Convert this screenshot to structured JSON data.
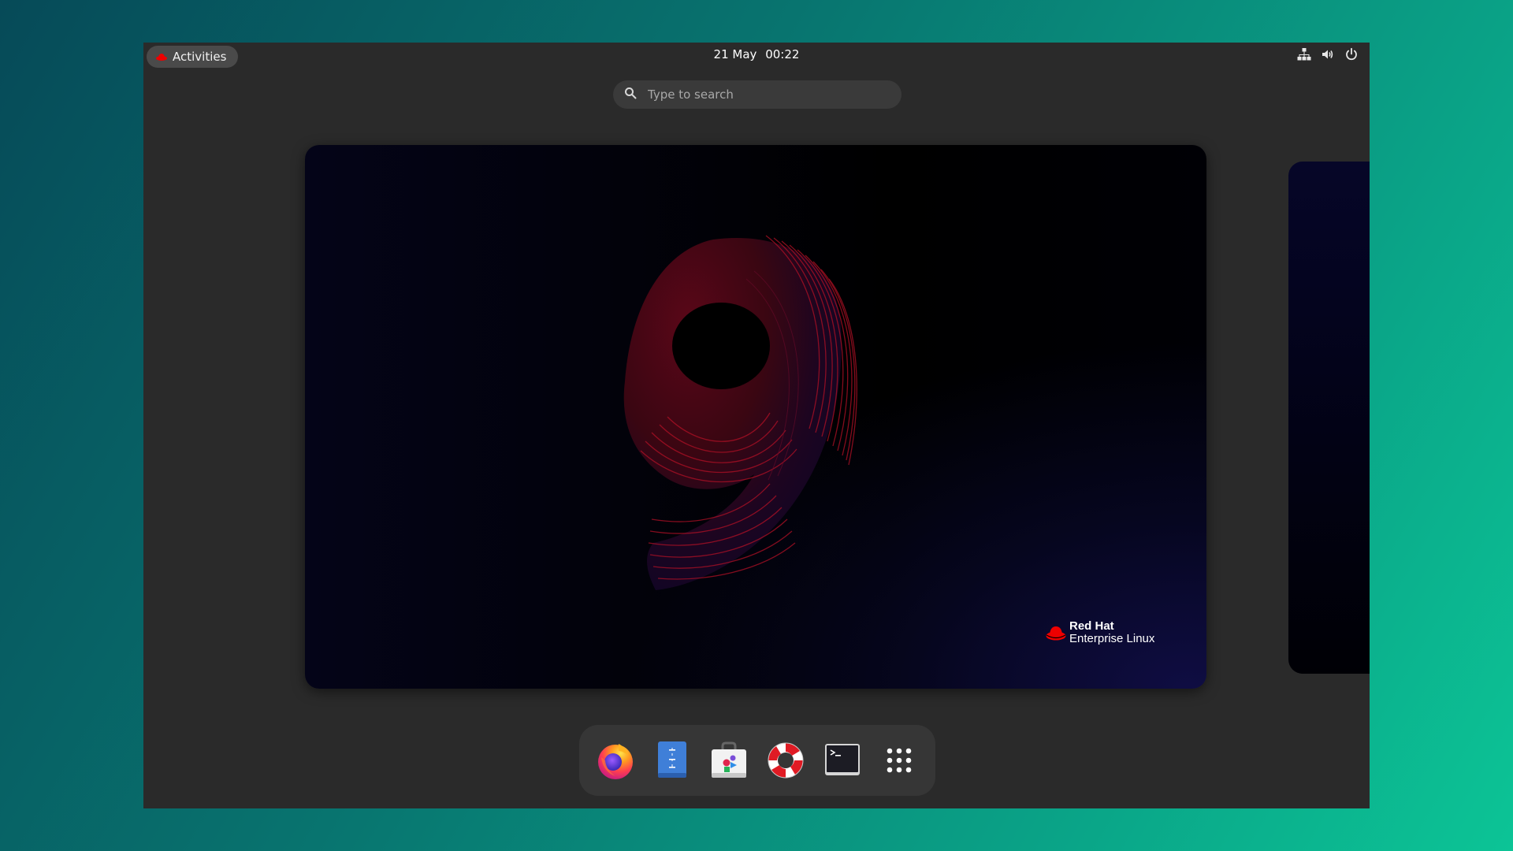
{
  "topbar": {
    "activities_label": "Activities",
    "date": "21 May",
    "time": "00:22",
    "tray_icons": [
      "network-icon",
      "volume-icon",
      "power-icon"
    ]
  },
  "search": {
    "placeholder": "Type to search"
  },
  "workspace": {
    "wallpaper_number": "9",
    "logo_line1": "Red Hat",
    "logo_line2": "Enterprise Linux"
  },
  "dock": {
    "apps": [
      "firefox-icon",
      "text-editor-icon",
      "software-store-icon",
      "help-icon",
      "terminal-icon",
      "show-apps-icon"
    ]
  },
  "colors": {
    "desktop_bg": "#2a2a2a",
    "accent_red": "#ee0000",
    "teal_bg_start": "#064a58",
    "teal_bg_end": "#0cc496"
  }
}
